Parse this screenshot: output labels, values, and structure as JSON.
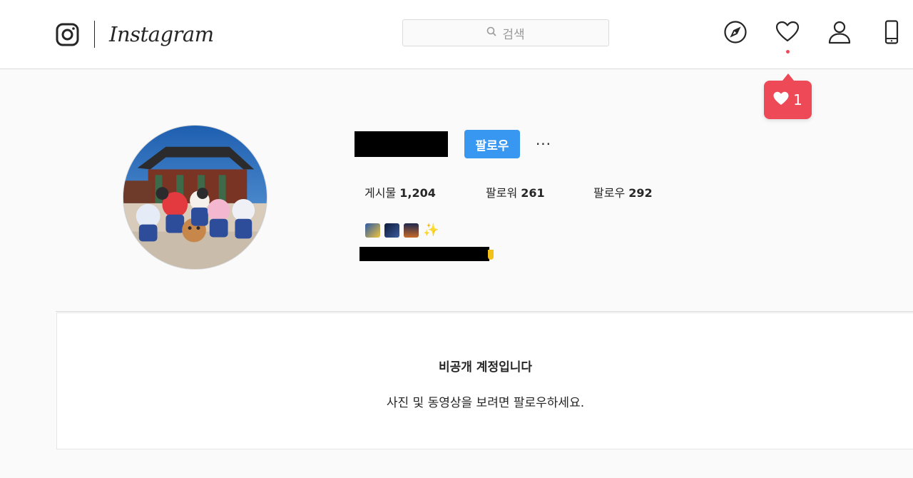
{
  "header": {
    "wordmark": "Instagram",
    "search_placeholder": "검색",
    "notification_count": "1",
    "accent_color": "#ed4956"
  },
  "profile": {
    "follow_label": "팔로우",
    "more_label": "···",
    "stats": [
      {
        "label": "게시물",
        "count": "1,204"
      },
      {
        "label": "팔로워",
        "count": "261"
      },
      {
        "label": "팔로우",
        "count": "292"
      }
    ],
    "bio_emoji": [
      "shooting-star-icon",
      "night-sky-icon",
      "bridge-at-night-icon",
      "sparkles-icon"
    ],
    "sparkle": "✨"
  },
  "private_notice": {
    "title": "비공개 계정입니다",
    "subtitle": "사진 및 동영상을 보려면 팔로우하세요."
  },
  "colors": {
    "follow_button": "#3897f0",
    "background": "#fafafa",
    "border": "#dbdbdb"
  }
}
